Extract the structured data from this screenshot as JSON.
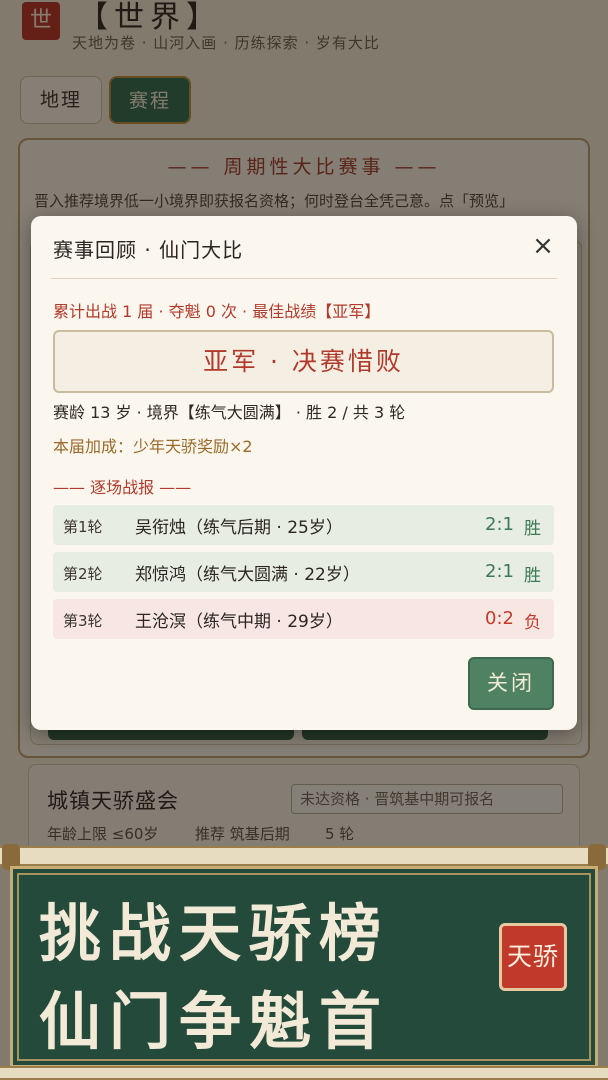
{
  "header": {
    "logo": "世",
    "title": "【世界】",
    "subtitle": "天地为卷 · 山河入画 · 历练探索 · 岁有大比"
  },
  "tabs": [
    {
      "label": "地理",
      "active": false
    },
    {
      "label": "赛程",
      "active": true
    }
  ],
  "panel": {
    "title": "—— 周期性大比赛事 ——",
    "description": "晋入推荐境界低一小境界即获报名资格；何时登台全凭己意。点「预览」"
  },
  "card2": {
    "title": "城镇天骄盛会",
    "badge": "未达资格 · 晋筑基中期可报名",
    "age_limit": "年龄上限 ≤60岁",
    "recommend": "推荐 筑基后期",
    "rounds": "5 轮"
  },
  "modal": {
    "title": "赛事回顾 · 仙门大比",
    "close_icon": "×",
    "summary": "累计出战 1 届 · 夺魁 0 次 · 最佳战绩【亚军】",
    "result": "亚军 · 决赛惜败",
    "stats": "赛龄 13 岁 · 境界【练气大圆满】 · 胜 2 / 共 3 轮",
    "bonus": "本届加成：少年天骄奖励×2",
    "section_title": "—— 逐场战报 ——",
    "matches": [
      {
        "round": "第1轮",
        "opponent": "吴衔烛（练气后期 · 25岁）",
        "score": "2:1",
        "result": "胜"
      },
      {
        "round": "第2轮",
        "opponent": "郑惊鸿（练气大圆满 · 22岁）",
        "score": "2:1",
        "result": "胜"
      },
      {
        "round": "第3轮",
        "opponent": "王沧溟（练气中期 · 29岁）",
        "score": "0:2",
        "result": "负"
      }
    ],
    "action_label": "关闭"
  },
  "promo": {
    "line1": "挑战天骄榜",
    "line2": "仙门争魁首",
    "seal": "天骄"
  },
  "colors": {
    "accent_green": "#2f6a4e",
    "accent_red": "#b23a2b",
    "win": "#3c7a55",
    "loss": "#c23b2b"
  }
}
